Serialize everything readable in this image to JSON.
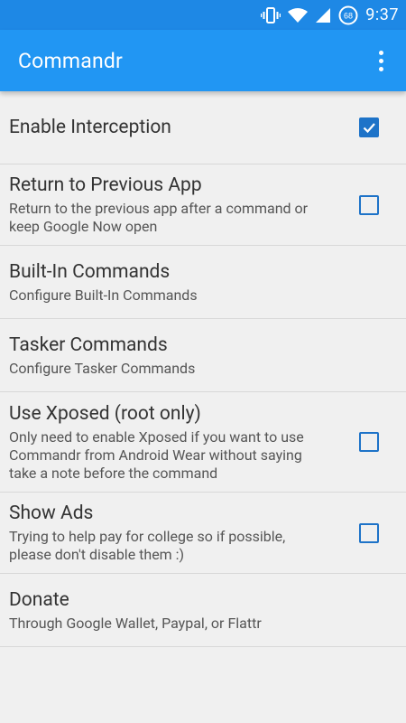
{
  "status_bar": {
    "time": "9:37",
    "battery_level": "68",
    "icons": [
      "vibrate-icon",
      "wifi-icon",
      "cell-signal-icon",
      "battery-icon"
    ]
  },
  "app_bar": {
    "title": "Commandr",
    "menu_icon": "overflow-menu-icon"
  },
  "colors": {
    "status_bar": "#1e88e5",
    "app_bar": "#2196f3",
    "accent": "#1e73c8",
    "background": "#f0f0f0"
  },
  "settings": [
    {
      "title": "Enable Interception",
      "summary": "",
      "has_checkbox": true,
      "checked": true
    },
    {
      "title": "Return to Previous App",
      "summary": "Return to the previous app after a command or keep Google Now open",
      "has_checkbox": true,
      "checked": false
    },
    {
      "title": "Built-In Commands",
      "summary": "Configure Built-In Commands",
      "has_checkbox": false
    },
    {
      "title": "Tasker Commands",
      "summary": "Configure Tasker Commands",
      "has_checkbox": false
    },
    {
      "title": "Use Xposed (root only)",
      "summary": "Only need to enable Xposed if you want to use Commandr from Android Wear without saying take a note before the command",
      "has_checkbox": true,
      "checked": false
    },
    {
      "title": "Show Ads",
      "summary": "Trying to help pay for college so if possible, please don't disable them :)",
      "has_checkbox": true,
      "checked": false
    },
    {
      "title": "Donate",
      "summary": "Through Google Wallet, Paypal, or Flattr",
      "has_checkbox": false
    }
  ]
}
